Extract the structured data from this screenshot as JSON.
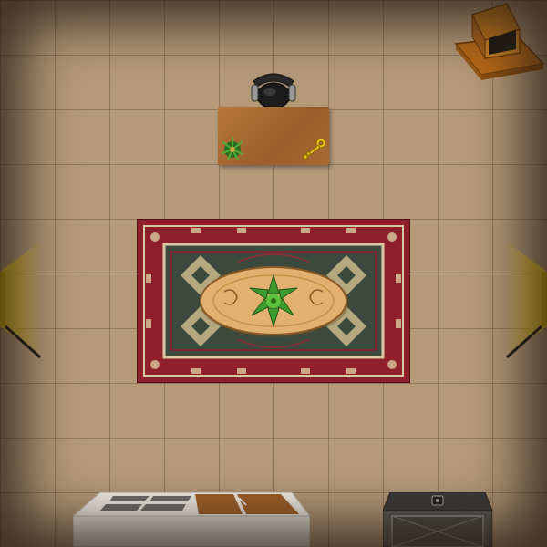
{
  "scene": {
    "floor_color": "#b59a7a",
    "accent_yellow": "#f2d11a",
    "rug_red": "#8f1f2a",
    "rug_green": "#3b4a3c"
  },
  "objects": {
    "left_nav_icon": "chevron-left-arrow",
    "right_nav_icon": "chevron-right-arrow",
    "key_icon": "gold-key",
    "plant_icon": "potted-plant"
  }
}
